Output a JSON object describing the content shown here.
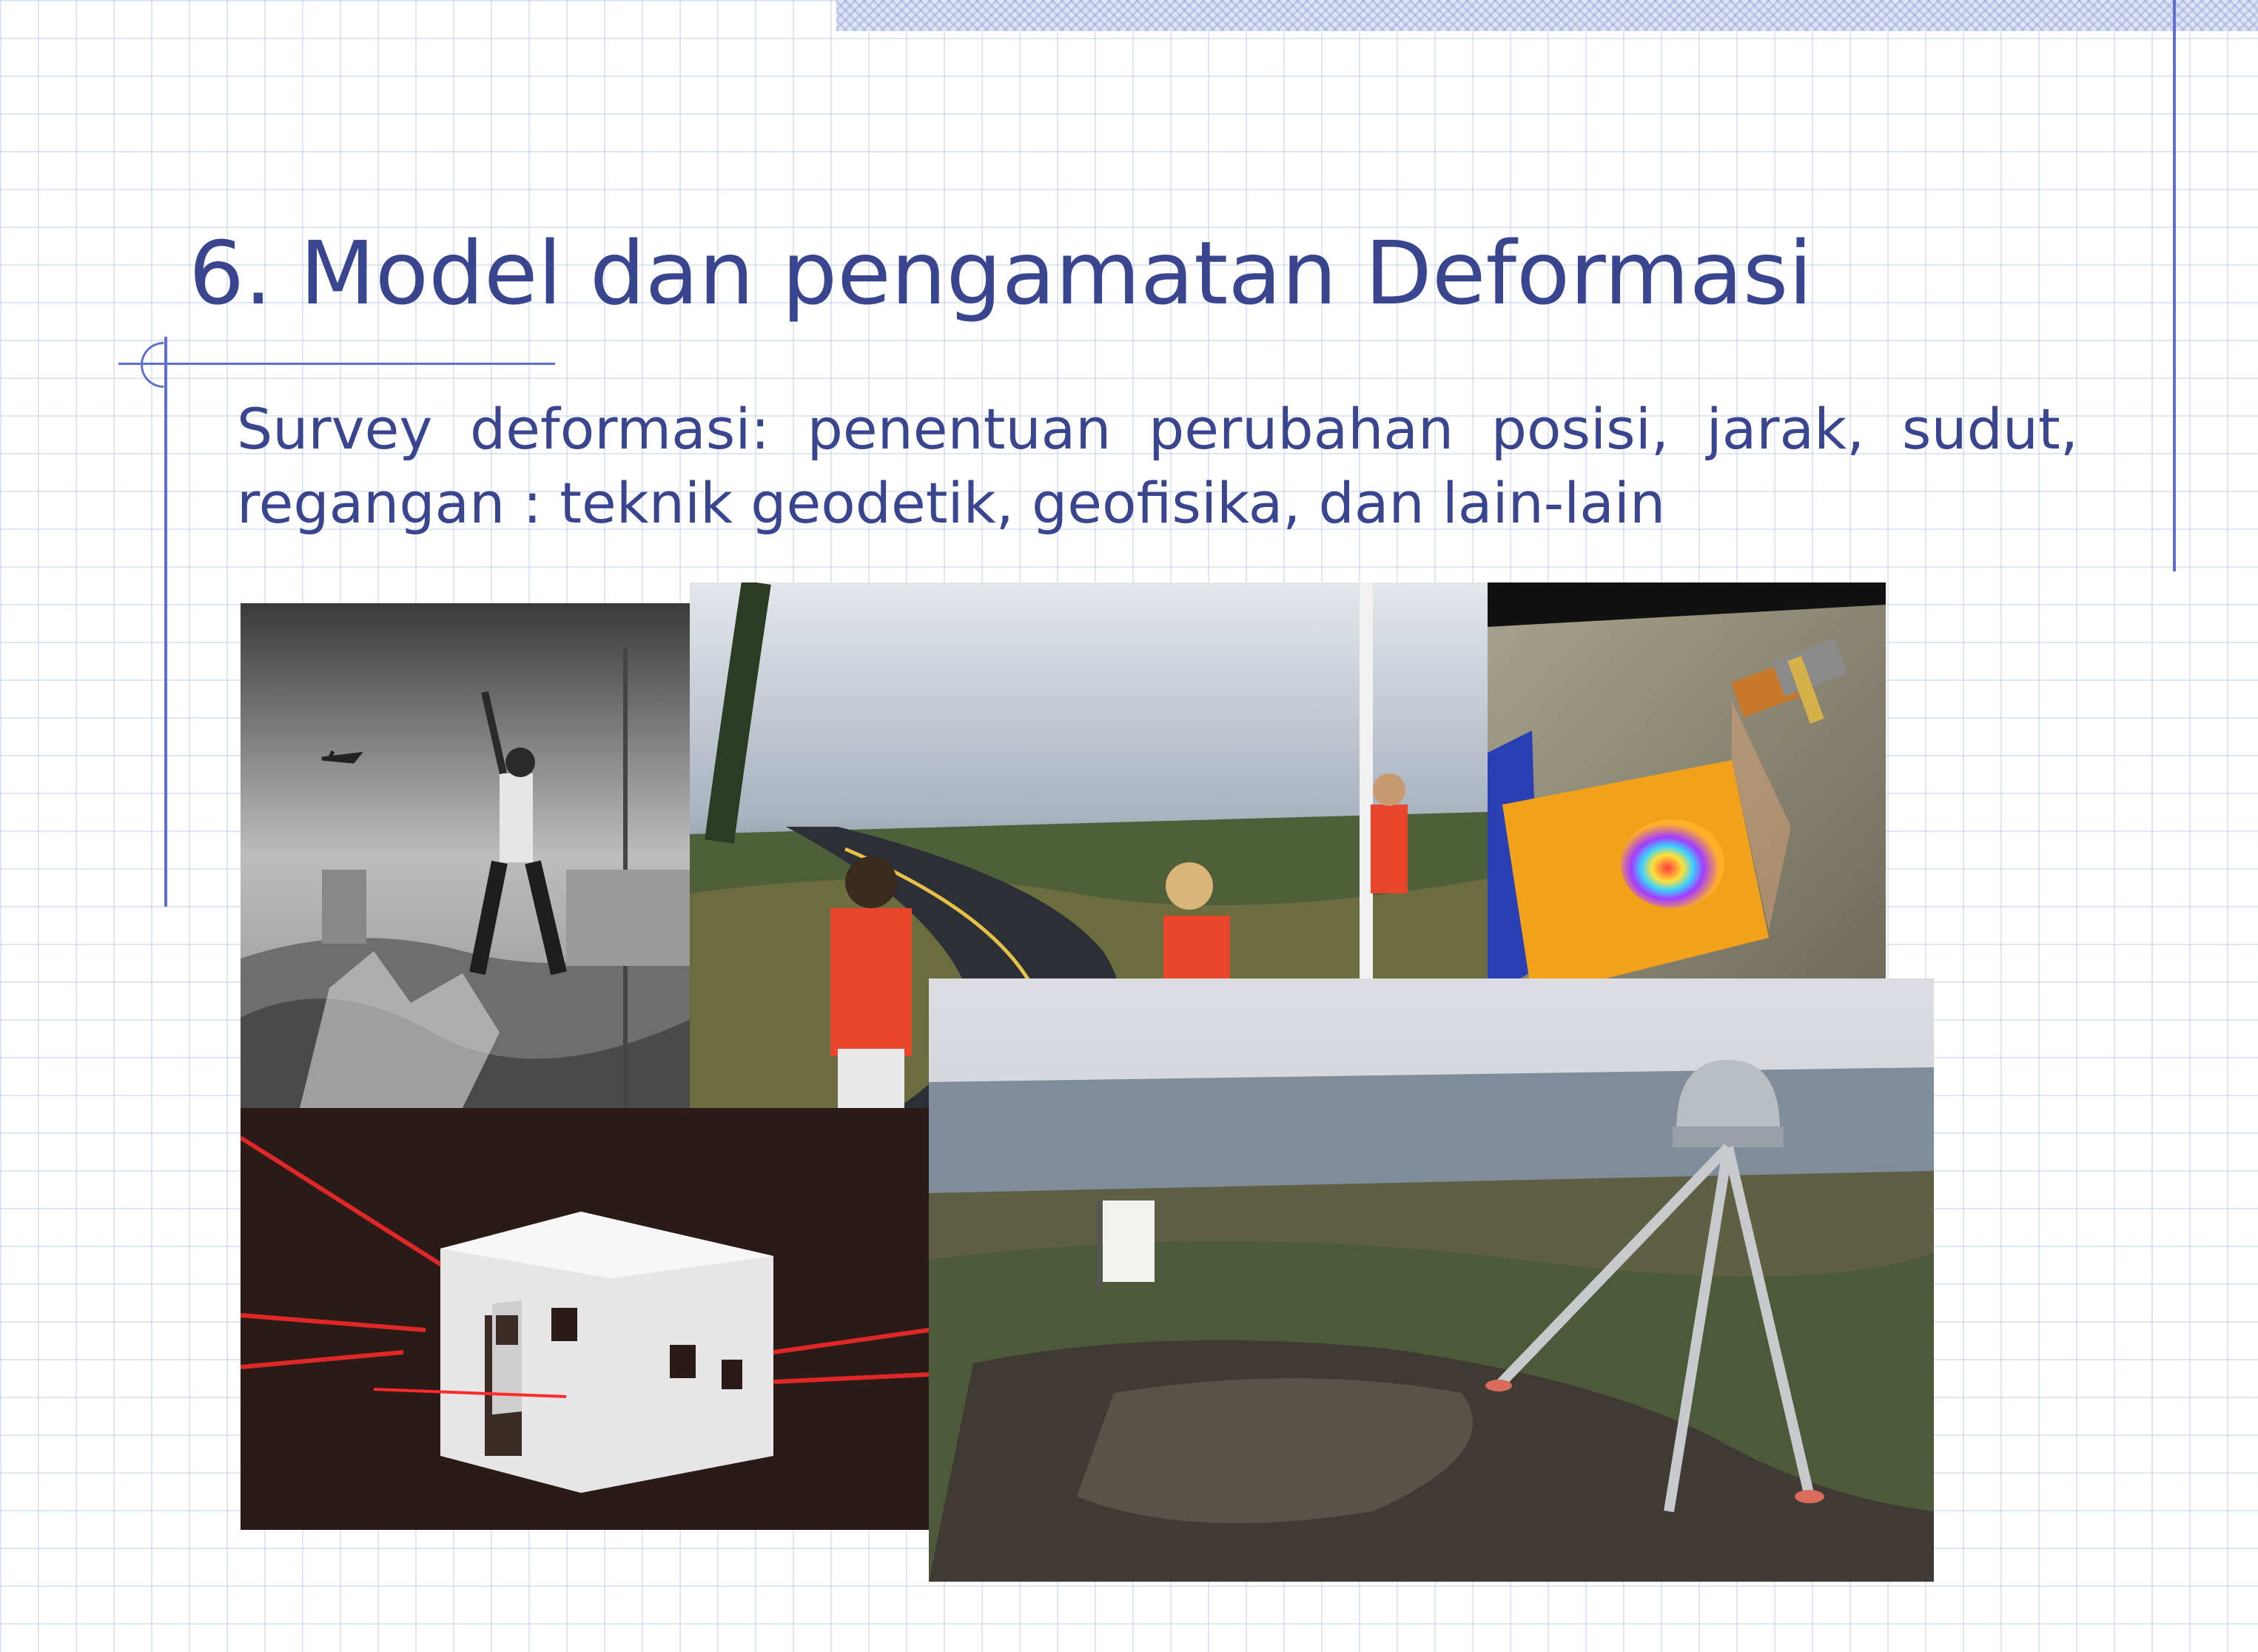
{
  "slide": {
    "title": "6. Model dan pengamatan Deformasi",
    "body": "Survey deformasi: penentuan perubahan posisi, jarak, sudut, regangan : teknik geodetik, geofisika, dan lain-lain"
  },
  "colors": {
    "text": "#3a4590",
    "accent_line": "#5f6fd1",
    "grid": "#aab9e1"
  },
  "photos": [
    {
      "name": "black-and-white-survey-photo"
    },
    {
      "name": "volcanic-road-survey-photo"
    },
    {
      "name": "satellite-insar-illustration"
    },
    {
      "name": "laser-ranging-hut-photo"
    },
    {
      "name": "gps-antenna-tripod-photo"
    }
  ]
}
